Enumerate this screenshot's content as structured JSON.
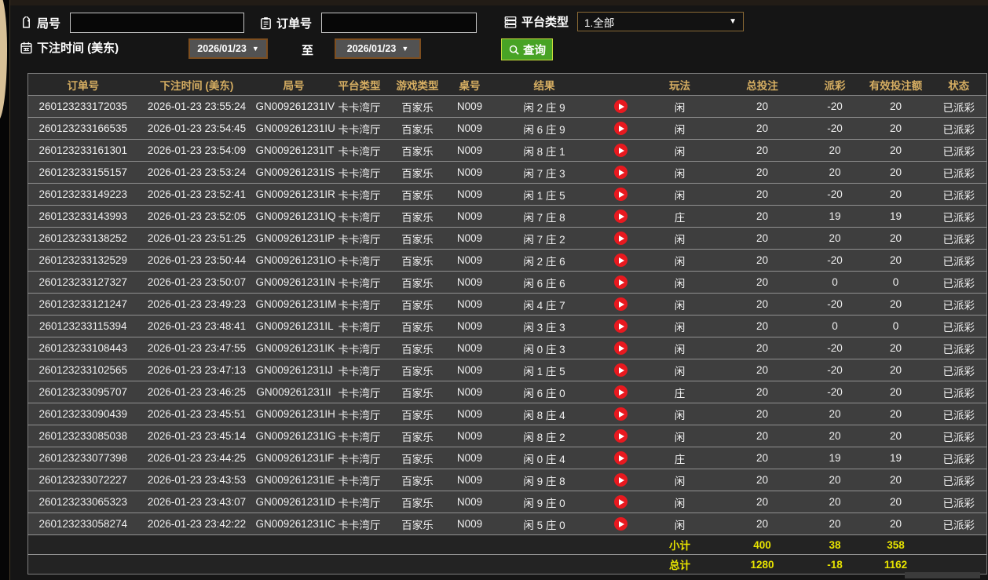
{
  "filters": {
    "round": {
      "label": "局号",
      "value": "",
      "icon": "tag-icon"
    },
    "order": {
      "label": "订单号",
      "value": "",
      "icon": "clipboard-icon"
    },
    "platform": {
      "label": "平台类型",
      "value": "1.全部",
      "icon": "stack-icon"
    },
    "bet_time": {
      "label": "下注时间 (美东)",
      "icon": "calendar-icon",
      "from": "2026/01/23",
      "to": "2026/01/23",
      "to_separator": "至"
    },
    "search_button": {
      "label": "查询",
      "icon": "magnifier-icon"
    }
  },
  "table": {
    "headers": [
      "订单号",
      "下注时间 (美东)",
      "局号",
      "平台类型",
      "游戏类型",
      "桌号",
      "结果",
      "玩法",
      "总投注",
      "派彩",
      "有效投注额",
      "状态"
    ],
    "rows": [
      {
        "order": "260123233172035",
        "time": "2026-01-23 23:55:24",
        "round": "GN009261231IV",
        "platform": "卡卡湾厅",
        "game": "百家乐",
        "table": "N009",
        "result": "闲 2 庄 9",
        "play": "闲",
        "total_bet": "20",
        "payout": "-20",
        "payout_class": "neg",
        "valid_bet": "20",
        "status": "已派彩"
      },
      {
        "order": "260123233166535",
        "time": "2026-01-23 23:54:45",
        "round": "GN009261231IU",
        "platform": "卡卡湾厅",
        "game": "百家乐",
        "table": "N009",
        "result": "闲 6 庄 9",
        "play": "闲",
        "total_bet": "20",
        "payout": "-20",
        "payout_class": "neg",
        "valid_bet": "20",
        "status": "已派彩"
      },
      {
        "order": "260123233161301",
        "time": "2026-01-23 23:54:09",
        "round": "GN009261231IT",
        "platform": "卡卡湾厅",
        "game": "百家乐",
        "table": "N009",
        "result": "闲 8 庄 1",
        "play": "闲",
        "total_bet": "20",
        "payout": "20",
        "payout_class": "pos",
        "valid_bet": "20",
        "status": "已派彩"
      },
      {
        "order": "260123233155157",
        "time": "2026-01-23 23:53:24",
        "round": "GN009261231IS",
        "platform": "卡卡湾厅",
        "game": "百家乐",
        "table": "N009",
        "result": "闲 7 庄 3",
        "play": "闲",
        "total_bet": "20",
        "payout": "20",
        "payout_class": "pos",
        "valid_bet": "20",
        "status": "已派彩"
      },
      {
        "order": "260123233149223",
        "time": "2026-01-23 23:52:41",
        "round": "GN009261231IR",
        "platform": "卡卡湾厅",
        "game": "百家乐",
        "table": "N009",
        "result": "闲 1 庄 5",
        "play": "闲",
        "total_bet": "20",
        "payout": "-20",
        "payout_class": "neg",
        "valid_bet": "20",
        "status": "已派彩"
      },
      {
        "order": "260123233143993",
        "time": "2026-01-23 23:52:05",
        "round": "GN009261231IQ",
        "platform": "卡卡湾厅",
        "game": "百家乐",
        "table": "N009",
        "result": "闲 7 庄 8",
        "play": "庄",
        "total_bet": "20",
        "payout": "19",
        "payout_class": "pos",
        "valid_bet": "19",
        "status": "已派彩"
      },
      {
        "order": "260123233138252",
        "time": "2026-01-23 23:51:25",
        "round": "GN009261231IP",
        "platform": "卡卡湾厅",
        "game": "百家乐",
        "table": "N009",
        "result": "闲 7 庄 2",
        "play": "闲",
        "total_bet": "20",
        "payout": "20",
        "payout_class": "pos",
        "valid_bet": "20",
        "status": "已派彩"
      },
      {
        "order": "260123233132529",
        "time": "2026-01-23 23:50:44",
        "round": "GN009261231IO",
        "platform": "卡卡湾厅",
        "game": "百家乐",
        "table": "N009",
        "result": "闲 2 庄 6",
        "play": "闲",
        "total_bet": "20",
        "payout": "-20",
        "payout_class": "neg",
        "valid_bet": "20",
        "status": "已派彩"
      },
      {
        "order": "260123233127327",
        "time": "2026-01-23 23:50:07",
        "round": "GN009261231IN",
        "platform": "卡卡湾厅",
        "game": "百家乐",
        "table": "N009",
        "result": "闲 6 庄 6",
        "play": "闲",
        "total_bet": "20",
        "payout": "0",
        "payout_class": "zero",
        "valid_bet": "0",
        "status": "已派彩"
      },
      {
        "order": "260123233121247",
        "time": "2026-01-23 23:49:23",
        "round": "GN009261231IM",
        "platform": "卡卡湾厅",
        "game": "百家乐",
        "table": "N009",
        "result": "闲 4 庄 7",
        "play": "闲",
        "total_bet": "20",
        "payout": "-20",
        "payout_class": "neg",
        "valid_bet": "20",
        "status": "已派彩"
      },
      {
        "order": "260123233115394",
        "time": "2026-01-23 23:48:41",
        "round": "GN009261231IL",
        "platform": "卡卡湾厅",
        "game": "百家乐",
        "table": "N009",
        "result": "闲 3 庄 3",
        "play": "闲",
        "total_bet": "20",
        "payout": "0",
        "payout_class": "zero",
        "valid_bet": "0",
        "status": "已派彩"
      },
      {
        "order": "260123233108443",
        "time": "2026-01-23 23:47:55",
        "round": "GN009261231IK",
        "platform": "卡卡湾厅",
        "game": "百家乐",
        "table": "N009",
        "result": "闲 0 庄 3",
        "play": "闲",
        "total_bet": "20",
        "payout": "-20",
        "payout_class": "neg",
        "valid_bet": "20",
        "status": "已派彩"
      },
      {
        "order": "260123233102565",
        "time": "2026-01-23 23:47:13",
        "round": "GN009261231IJ",
        "platform": "卡卡湾厅",
        "game": "百家乐",
        "table": "N009",
        "result": "闲 1 庄 5",
        "play": "闲",
        "total_bet": "20",
        "payout": "-20",
        "payout_class": "neg",
        "valid_bet": "20",
        "status": "已派彩"
      },
      {
        "order": "260123233095707",
        "time": "2026-01-23 23:46:25",
        "round": "GN009261231II",
        "platform": "卡卡湾厅",
        "game": "百家乐",
        "table": "N009",
        "result": "闲 6 庄 0",
        "play": "庄",
        "total_bet": "20",
        "payout": "-20",
        "payout_class": "neg",
        "valid_bet": "20",
        "status": "已派彩"
      },
      {
        "order": "260123233090439",
        "time": "2026-01-23 23:45:51",
        "round": "GN009261231IH",
        "platform": "卡卡湾厅",
        "game": "百家乐",
        "table": "N009",
        "result": "闲 8 庄 4",
        "play": "闲",
        "total_bet": "20",
        "payout": "20",
        "payout_class": "pos",
        "valid_bet": "20",
        "status": "已派彩"
      },
      {
        "order": "260123233085038",
        "time": "2026-01-23 23:45:14",
        "round": "GN009261231IG",
        "platform": "卡卡湾厅",
        "game": "百家乐",
        "table": "N009",
        "result": "闲 8 庄 2",
        "play": "闲",
        "total_bet": "20",
        "payout": "20",
        "payout_class": "pos",
        "valid_bet": "20",
        "status": "已派彩"
      },
      {
        "order": "260123233077398",
        "time": "2026-01-23 23:44:25",
        "round": "GN009261231IF",
        "platform": "卡卡湾厅",
        "game": "百家乐",
        "table": "N009",
        "result": "闲 0 庄 4",
        "play": "庄",
        "total_bet": "20",
        "payout": "19",
        "payout_class": "pos",
        "valid_bet": "19",
        "status": "已派彩"
      },
      {
        "order": "260123233072227",
        "time": "2026-01-23 23:43:53",
        "round": "GN009261231IE",
        "platform": "卡卡湾厅",
        "game": "百家乐",
        "table": "N009",
        "result": "闲 9 庄 8",
        "play": "闲",
        "total_bet": "20",
        "payout": "20",
        "payout_class": "pos",
        "valid_bet": "20",
        "status": "已派彩"
      },
      {
        "order": "260123233065323",
        "time": "2026-01-23 23:43:07",
        "round": "GN009261231ID",
        "platform": "卡卡湾厅",
        "game": "百家乐",
        "table": "N009",
        "result": "闲 9 庄 0",
        "play": "闲",
        "total_bet": "20",
        "payout": "20",
        "payout_class": "pos",
        "valid_bet": "20",
        "status": "已派彩"
      },
      {
        "order": "260123233058274",
        "time": "2026-01-23 23:42:22",
        "round": "GN009261231IC",
        "platform": "卡卡湾厅",
        "game": "百家乐",
        "table": "N009",
        "result": "闲 5 庄 0",
        "play": "闲",
        "total_bet": "20",
        "payout": "20",
        "payout_class": "pos",
        "valid_bet": "20",
        "status": "已派彩"
      }
    ],
    "subtotal": {
      "label": "小计",
      "total_bet": "400",
      "payout": "38",
      "valid_bet": "358"
    },
    "grand_total": {
      "label": "总计",
      "total_bet": "1280",
      "payout": "-18",
      "valid_bet": "1162"
    }
  },
  "colors": {
    "header_text": "#d6ae62",
    "payout_win_red": "#c01414",
    "payout_loss_green": "#8ed300",
    "totals_yellow": "#e8e400",
    "status_paid_green": "#25c525",
    "search_button_green": "#48a325",
    "play_button_red": "#e8191f",
    "date_select_border_brown": "#7d4e1f",
    "row_background": "#3e3e3e"
  }
}
